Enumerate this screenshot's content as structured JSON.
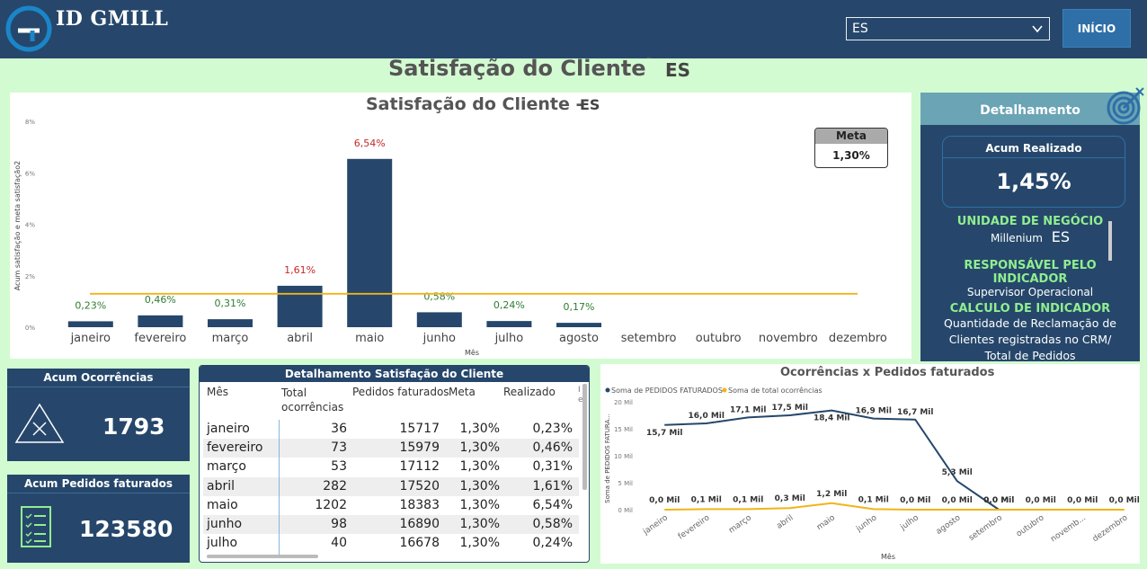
{
  "header": {
    "brand": "ID GMILL",
    "select_value": "ES",
    "inicio_label": "INÍCIO"
  },
  "page": {
    "title": "Satisfação do Cliente",
    "dash": "-",
    "subtitle": "ES"
  },
  "chart_data": [
    {
      "type": "bar",
      "title": "Satisfação do Cliente -",
      "subtitle": "ES",
      "xlabel": "Mês",
      "ylabel": "Acum satisfação e meta satisfação2",
      "ylim": [
        0,
        8
      ],
      "yticks": [
        "0%",
        "2%",
        "4%",
        "6%",
        "8%"
      ],
      "categories": [
        "janeiro",
        "fevereiro",
        "março",
        "abril",
        "maio",
        "junho",
        "julho",
        "agosto",
        "setembro",
        "outubro",
        "novembro",
        "dezembro"
      ],
      "values": [
        0.23,
        0.46,
        0.31,
        1.61,
        6.54,
        0.58,
        0.24,
        0.17,
        null,
        null,
        null,
        null
      ],
      "value_labels": [
        "0,23%",
        "0,46%",
        "0,31%",
        "1,61%",
        "6,54%",
        "0,58%",
        "0,24%",
        "0,17%",
        "",
        "",
        "",
        ""
      ],
      "meta_line": 1.3,
      "meta_box": {
        "title": "Meta",
        "value": "1,30%"
      },
      "colors": {
        "bar": "#26476b",
        "meta": "#f2b418",
        "label_below": "#2e7d32",
        "label_above": "#c62828"
      }
    },
    {
      "type": "line",
      "title": "Ocorrências x Pedidos faturados",
      "xlabel": "Mês",
      "ylabel": "Soma de PEDIDOS FATURA...",
      "ylim": [
        0,
        20
      ],
      "yticks": [
        "0 Mil",
        "5 Mil",
        "10 Mil",
        "15 Mil",
        "20 Mil"
      ],
      "categories": [
        "janeiro",
        "fevereiro",
        "março",
        "abril",
        "maio",
        "junho",
        "julho",
        "agosto",
        "setembro",
        "outubro",
        "novemb...",
        "dezembro"
      ],
      "series": [
        {
          "name": "Soma de PEDIDOS FATURADOS",
          "color": "#26476b",
          "values": [
            15.7,
            16.0,
            17.1,
            17.5,
            18.4,
            16.9,
            16.7,
            5.3,
            0.0,
            null,
            null,
            null
          ],
          "labels": [
            "15,7 Mil",
            "16,0 Mil",
            "17,1 Mil",
            "17,5 Mil",
            "18,4 Mil",
            "16,9 Mil",
            "16,7 Mil",
            "5,3 Mil",
            "0,0 Mil",
            "",
            "",
            ""
          ]
        },
        {
          "name": "Soma de total ocorrências",
          "color": "#f2b418",
          "values": [
            0.0,
            0.1,
            0.1,
            0.3,
            1.2,
            0.1,
            0.0,
            0.0,
            0.0,
            0.0,
            0.0,
            0.0
          ],
          "labels": [
            "0,0 Mil",
            "0,1 Mil",
            "0,1 Mil",
            "0,3 Mil",
            "1,2 Mil",
            "0,1 Mil",
            "0,0 Mil",
            "0,0 Mil",
            "0,0 Mil",
            "0,0 Mil",
            "0,0 Mil",
            "0,0 Mil"
          ]
        }
      ]
    }
  ],
  "detalhamento": {
    "title": "Detalhamento",
    "acum_label": "Acum Realizado",
    "acum_value": "1,45%",
    "unidade_label": "UNIDADE DE NEGÓCIO",
    "unidade_value": "Millenium",
    "unidade_code": "ES",
    "resp_label": "RESPONSÁVEL PELO INDICADOR",
    "resp_value": "Supervisor Operacional",
    "calc_label": "CÁLCULO DE INDICADOR",
    "calc_value": "Quantidade de Reclamação de Clientes registradas no CRM/ Total de Pedidos"
  },
  "kpis": {
    "ocorrencias": {
      "label": "Acum Ocorrências",
      "value": "1793"
    },
    "pedidos": {
      "label": "Acum Pedidos faturados",
      "value": "123580"
    }
  },
  "table": {
    "title": "Detalhamento Satisfação do Cliente",
    "columns": [
      "Mês",
      "Total ocorrências",
      "Pedidos faturados",
      "Meta",
      "Realizado",
      "I e"
    ],
    "rows": [
      [
        "janeiro",
        "36",
        "15717",
        "1,30%",
        "0,23%"
      ],
      [
        "fevereiro",
        "73",
        "15979",
        "1,30%",
        "0,46%"
      ],
      [
        "março",
        "53",
        "17112",
        "1,30%",
        "0,31%"
      ],
      [
        "abril",
        "282",
        "17520",
        "1,30%",
        "1,61%"
      ],
      [
        "maio",
        "1202",
        "18383",
        "1,30%",
        "6,54%"
      ],
      [
        "junho",
        "98",
        "16890",
        "1,30%",
        "0,58%"
      ],
      [
        "julho",
        "40",
        "16678",
        "1,30%",
        "0,24%"
      ]
    ]
  }
}
